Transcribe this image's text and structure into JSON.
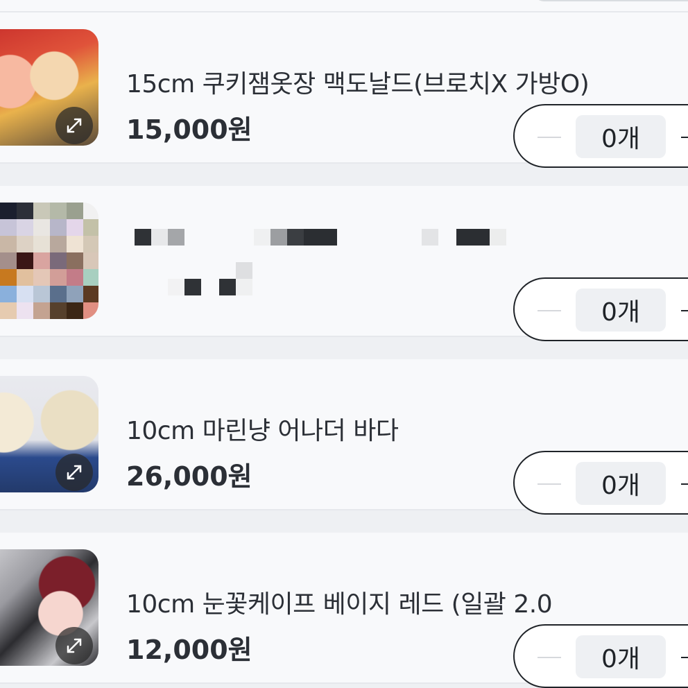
{
  "products": [
    {
      "name": "15cm 쿠키잼옷장 맥도날드(브로치X 가방O)",
      "price": "15,000원",
      "quantity": "0개",
      "thumb_icon": "expand-icon"
    },
    {
      "name": "",
      "price": "",
      "quantity": "0개",
      "thumb_icon": ""
    },
    {
      "name": "10cm 마린냥 어나더 바다",
      "price": "26,000원",
      "quantity": "0개",
      "thumb_icon": "expand-icon"
    },
    {
      "name": "10cm 눈꽃케이프 베이지 레드 (일괄 2.0",
      "price": "12,000원",
      "quantity": "0개",
      "thumb_icon": "expand-icon"
    }
  ],
  "colors": {
    "background": "#eef0f3",
    "card": "#f8f9fb",
    "text": "#2b2f36",
    "stepper_border": "#1f2328",
    "qty_bg": "#eef0f3"
  }
}
